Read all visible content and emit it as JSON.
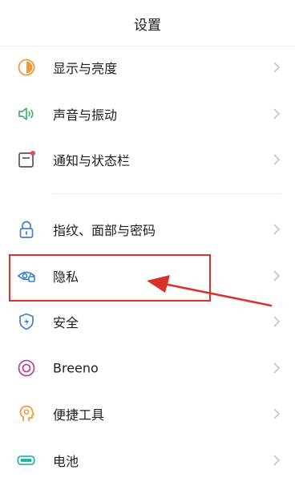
{
  "header": {
    "title": "设置"
  },
  "items": [
    {
      "label": "显示与亮度",
      "icon": "brightness-icon"
    },
    {
      "label": "声音与振动",
      "icon": "sound-icon"
    },
    {
      "label": "通知与状态栏",
      "icon": "notification-icon"
    },
    {
      "label": "指纹、面部与密码",
      "icon": "lock-icon"
    },
    {
      "label": "隐私",
      "icon": "privacy-icon"
    },
    {
      "label": "安全",
      "icon": "shield-icon"
    },
    {
      "label": "Breeno",
      "icon": "breeno-icon"
    },
    {
      "label": "便捷工具",
      "icon": "tools-icon"
    },
    {
      "label": "电池",
      "icon": "battery-icon"
    }
  ],
  "colors": {
    "orange": "#f29a38",
    "green": "#3db36a",
    "blue": "#3f7fd4",
    "purple": "#b24aa6",
    "teal": "#1fb2a0",
    "annotation_red": "#d9312b",
    "chevron": "#c5c5c5"
  }
}
